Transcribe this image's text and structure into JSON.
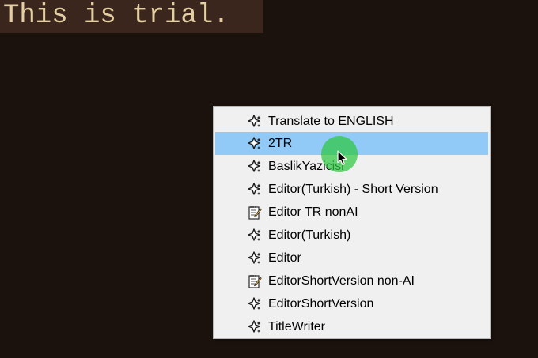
{
  "editor": {
    "text": "This is trial."
  },
  "context_menu": {
    "items": [
      {
        "label": "Translate to ENGLISH",
        "icon": "sparkle-icon",
        "highlighted": false
      },
      {
        "label": "2TR",
        "icon": "sparkle-icon",
        "highlighted": true
      },
      {
        "label": "BaslikYazicisi",
        "icon": "sparkle-icon",
        "highlighted": false
      },
      {
        "label": "Editor(Turkish) - Short Version",
        "icon": "sparkle-icon",
        "highlighted": false
      },
      {
        "label": "Editor TR nonAI",
        "icon": "notepad-icon",
        "highlighted": false
      },
      {
        "label": "Editor(Turkish)",
        "icon": "sparkle-icon",
        "highlighted": false
      },
      {
        "label": "Editor",
        "icon": "sparkle-icon",
        "highlighted": false
      },
      {
        "label": "EditorShortVersion non-AI",
        "icon": "notepad-icon",
        "highlighted": false
      },
      {
        "label": "EditorShortVersion",
        "icon": "sparkle-icon",
        "highlighted": false
      },
      {
        "label": "TitleWriter",
        "icon": "sparkle-icon",
        "highlighted": false
      }
    ]
  },
  "colors": {
    "background": "#1b120e",
    "editor_line": "#3a261d",
    "editor_text": "#e3cfa2",
    "menu_background": "#f0f0f0",
    "menu_highlight": "#91c9f7",
    "cursor_halo": "#2ec840"
  }
}
